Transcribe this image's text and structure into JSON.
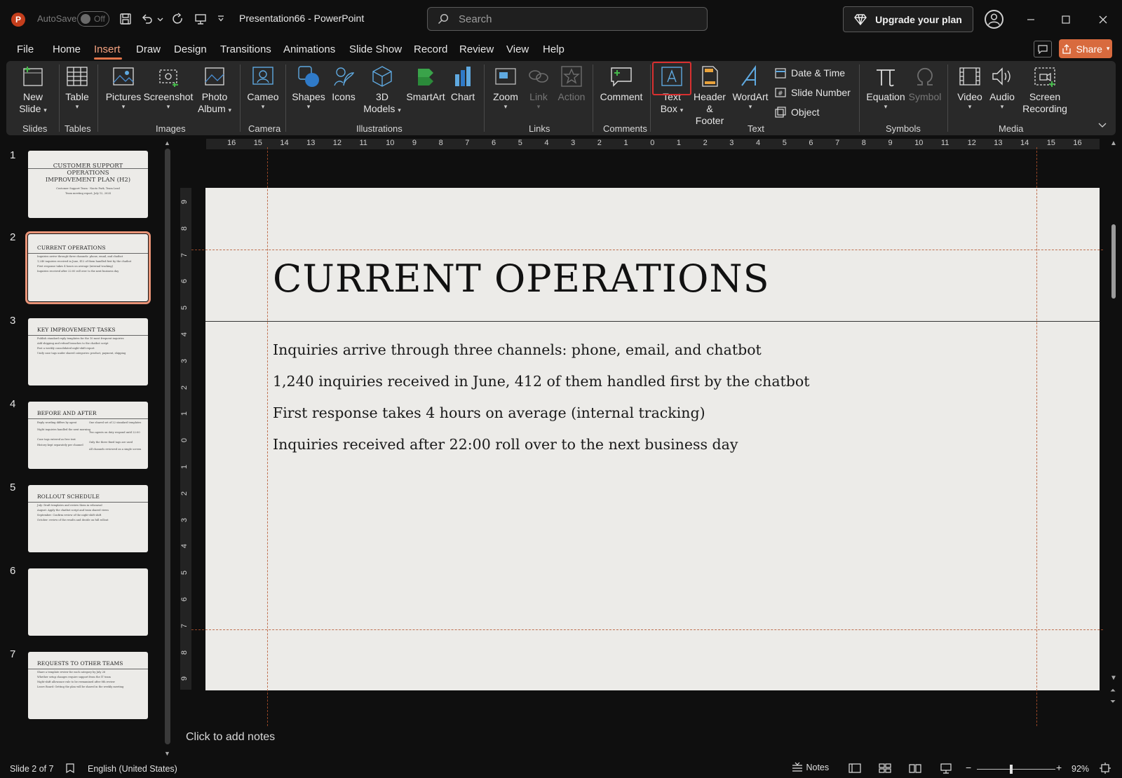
{
  "window": {
    "autosave_label": "AutoSave",
    "autosave_state": "Off",
    "doc_title": "Presentation66  -  PowerPoint",
    "search_placeholder": "Search",
    "upgrade_label": "Upgrade your plan"
  },
  "menu": {
    "tabs": [
      "File",
      "Home",
      "Insert",
      "Draw",
      "Design",
      "Transitions",
      "Animations",
      "Slide Show",
      "Record",
      "Review",
      "View",
      "Help"
    ],
    "active": "Insert",
    "share_label": "Share"
  },
  "ribbon": {
    "groups": {
      "slides": "Slides",
      "tables": "Tables",
      "images": "Images",
      "camera": "Camera",
      "illustrations": "Illustrations",
      "links": "Links",
      "comments": "Comments",
      "text": "Text",
      "symbols": "Symbols",
      "media": "Media"
    },
    "buttons": {
      "new_slide": [
        "New",
        "Slide"
      ],
      "table": "Table",
      "pictures": "Pictures",
      "screenshot": "Screenshot",
      "photo_album": [
        "Photo",
        "Album"
      ],
      "cameo": "Cameo",
      "shapes": "Shapes",
      "icons": "Icons",
      "models_3d": [
        "3D",
        "Models"
      ],
      "smartart": "SmartArt",
      "chart": "Chart",
      "zoom": "Zoom",
      "link": "Link",
      "action": "Action",
      "comment": "Comment",
      "text_box": [
        "Text",
        "Box"
      ],
      "header_footer": [
        "Header",
        "& Footer"
      ],
      "wordart": "WordArt",
      "date_time": "Date & Time",
      "slide_number": "Slide Number",
      "object": "Object",
      "equation": "Equation",
      "symbol": "Symbol",
      "video": "Video",
      "audio": "Audio",
      "screen_recording": [
        "Screen",
        "Recording"
      ]
    }
  },
  "thumbnails": [
    {
      "num": "1",
      "title_lines": [
        "CUSTOMER SUPPORT",
        "OPERATIONS",
        "IMPROVEMENT PLAN (H2)"
      ],
      "subtitle_lines": [
        "Customer Support Team · Naoto Park, Team Lead",
        "Team meeting report, July 12, 2024"
      ]
    },
    {
      "num": "2",
      "title": "CURRENT OPERATIONS",
      "lines": [
        "Inquiries arrive through three channels: phone, email, and chatbot",
        "1,240 inquiries received in June, 412 of them handled first by the chatbot",
        "First response takes 4 hours on average (internal tracking)",
        "Inquiries received after 22:00 roll over to the next business day"
      ]
    },
    {
      "num": "3",
      "title": "KEY IMPROVEMENT TASKS",
      "lines": [
        "Publish standard reply templates for the 10 most frequent inquiries",
        "Add shipping and refund branches to the chatbot script",
        "Post a weekly consolidated night-shift report",
        "Unify case tags under shared categories: product, payment, shipping"
      ]
    },
    {
      "num": "4",
      "title": "BEFORE AND AFTER",
      "left": [
        "Reply wording differs by agent",
        "Night inquiries handled the next morning",
        "Case tags entered as free text",
        "History kept separately per channel"
      ],
      "right": [
        "One shared set of 22 standard templates",
        "Two agents on duty respond until 22:00",
        "Only the three fixed tags are used",
        "All channels reviewed on a single screen"
      ]
    },
    {
      "num": "5",
      "title": "ROLLOUT SCHEDULE",
      "lines": [
        "July: Draft templates and review them in rehearsal",
        "August: Apply the chatbot script and train shared views",
        "September: Confirm review of the night-shift shift",
        "October: review of the results and decide on full rollout"
      ]
    },
    {
      "num": "6"
    },
    {
      "num": "7",
      "title": "REQUESTS TO OTHER TEAMS",
      "lines": [
        "Share a template review for each category by July 26",
        "Whether setup changes require support from the IT team",
        "Night-shift allowance rule to be reexamined after 8th review",
        "Leave Board: Getting the plan will be shared in the weekly meeting"
      ]
    }
  ],
  "slide": {
    "title": "CURRENT OPERATIONS",
    "bullets": [
      "Inquiries arrive through three channels: phone, email, and chatbot",
      "1,240 inquiries received in June, 412 of them handled first by the chatbot",
      "First response takes 4 hours on average (internal tracking)",
      "Inquiries received after 22:00 roll over to the next business day"
    ]
  },
  "rulers": {
    "horizontal": [
      "16",
      "15",
      "14",
      "13",
      "12",
      "11",
      "10",
      "9",
      "8",
      "7",
      "6",
      "5",
      "4",
      "3",
      "2",
      "1",
      "0",
      "1",
      "2",
      "3",
      "4",
      "5",
      "6",
      "7",
      "8",
      "9",
      "10",
      "11",
      "12",
      "13",
      "14",
      "15",
      "16"
    ],
    "vertical": [
      "9",
      "8",
      "7",
      "6",
      "5",
      "4",
      "3",
      "2",
      "1",
      "0",
      "1",
      "2",
      "3",
      "4",
      "5",
      "6",
      "7",
      "8",
      "9"
    ]
  },
  "notes_placeholder": "Click to add notes",
  "status": {
    "slide_counter": "Slide 2 of 7",
    "language": "English (United States)",
    "notes": "Notes",
    "zoom": "92%"
  },
  "colors": {
    "accent": "#e2754a",
    "share": "#d86a3e",
    "highlight": "#d83030",
    "slide_bg": "#ecebe8"
  }
}
